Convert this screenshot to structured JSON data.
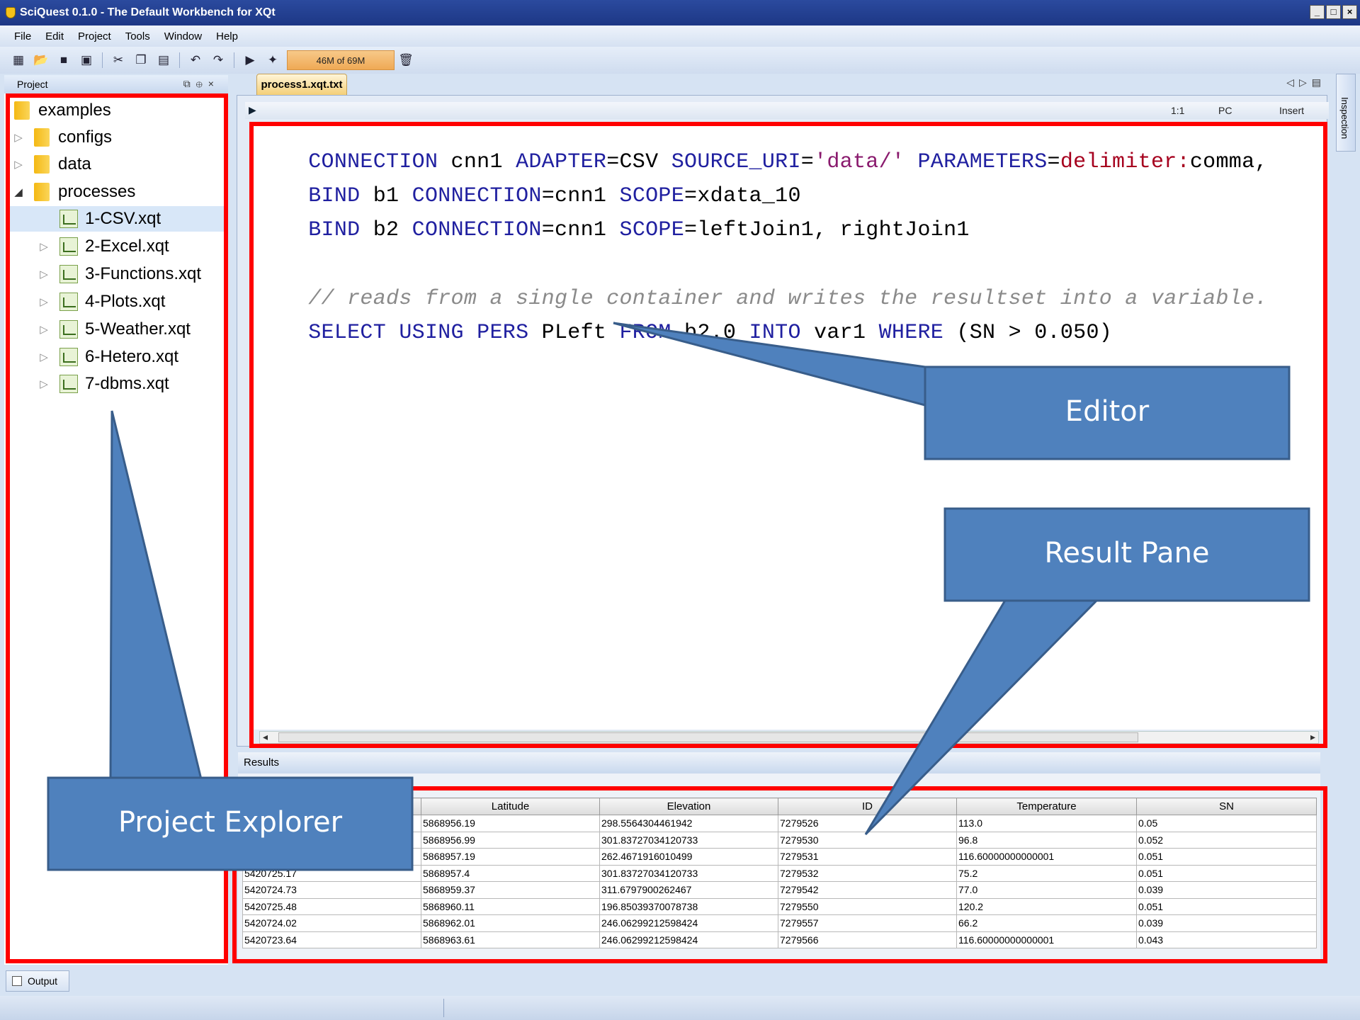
{
  "window": {
    "title": "SciQuest 0.1.0 - The Default Workbench for XQt",
    "controls": [
      "_",
      "□",
      "×"
    ]
  },
  "menu": [
    "File",
    "Edit",
    "Project",
    "Tools",
    "Window",
    "Help"
  ],
  "toolbar": {
    "icons": [
      "new-icon",
      "open-folder-icon",
      "save-icon",
      "save-all-icon",
      "cut-icon",
      "copy-icon",
      "paste-icon",
      "undo-icon",
      "redo-icon",
      "run-icon",
      "debug-icon",
      "trash-icon"
    ],
    "memory": "46M of 69M"
  },
  "project_panel": {
    "title": "Project",
    "tree": [
      {
        "label": "examples",
        "kind": "folder",
        "level": 0,
        "arrow": ""
      },
      {
        "label": "configs",
        "kind": "folder",
        "level": 1,
        "arrow": "▷"
      },
      {
        "label": "data",
        "kind": "folder",
        "level": 1,
        "arrow": "▷"
      },
      {
        "label": "processes",
        "kind": "folder",
        "level": 1,
        "arrow": "◢"
      },
      {
        "label": "1-CSV.xqt",
        "kind": "file",
        "level": 2,
        "arrow": "",
        "selected": true
      },
      {
        "label": "2-Excel.xqt",
        "kind": "file",
        "level": 2,
        "arrow": "▷"
      },
      {
        "label": "3-Functions.xqt",
        "kind": "file",
        "level": 2,
        "arrow": "▷"
      },
      {
        "label": "4-Plots.xqt",
        "kind": "file",
        "level": 2,
        "arrow": "▷"
      },
      {
        "label": "5-Weather.xqt",
        "kind": "file",
        "level": 2,
        "arrow": "▷"
      },
      {
        "label": "6-Hetero.xqt",
        "kind": "file",
        "level": 2,
        "arrow": "▷"
      },
      {
        "label": "7-dbms.xqt",
        "kind": "file",
        "level": 2,
        "arrow": "▷"
      }
    ]
  },
  "editor": {
    "tab": "process1.xqt.txt",
    "status": {
      "position": "1:1",
      "encoding": "PC",
      "mode": "Insert"
    },
    "lines": {
      "l1": {
        "k1": "CONNECTION",
        "t1": " cnn1 ",
        "k2": "ADAPTER",
        "t2": "=CSV ",
        "k3": "SOURCE_URI",
        "t3": "=",
        "s1": "'data/'",
        "t4": " ",
        "k4": "PARAMETERS",
        "t5": "=",
        "p1": "delimiter:",
        "t6": "comma,"
      },
      "l2": {
        "k1": "BIND",
        "t1": " b1 ",
        "k2": "CONNECTION",
        "t2": "=cnn1 ",
        "k3": "SCOPE",
        "t3": "=xdata_10"
      },
      "l3": {
        "k1": "BIND",
        "t1": " b2 ",
        "k2": "CONNECTION",
        "t2": "=cnn1 ",
        "k3": "SCOPE",
        "t3": "=leftJoin1, rightJoin1"
      },
      "l4": {
        "c1": "// reads from a single container and writes the resultset into a variable."
      },
      "l5": {
        "k1": "SELECT USING PERS",
        "t1": " PLeft ",
        "k2": "FROM",
        "t2": " b2.0 ",
        "k3": "INTO",
        "t3": " var1 ",
        "k4": "WHERE",
        "t4": " (SN > 0.050)"
      }
    }
  },
  "results": {
    "title": "Results",
    "columns": [
      "",
      "Latitude",
      "Elevation",
      "ID",
      "Temperature",
      "SN"
    ],
    "rows": [
      [
        "",
        "5868956.19",
        "298.5564304461942",
        "7279526",
        "113.0",
        "0.05"
      ],
      [
        "",
        "5868956.99",
        "301.83727034120733",
        "7279530",
        "96.8",
        "0.052"
      ],
      [
        "",
        "5868957.19",
        "262.4671916010499",
        "7279531",
        "116.60000000000001",
        "0.051"
      ],
      [
        "5420725.17",
        "5868957.4",
        "301.83727034120733",
        "7279532",
        "75.2",
        "0.051"
      ],
      [
        "5420724.73",
        "5868959.37",
        "311.6797900262467",
        "7279542",
        "77.0",
        "0.039"
      ],
      [
        "5420725.48",
        "5868960.11",
        "196.85039370078738",
        "7279550",
        "120.2",
        "0.051"
      ],
      [
        "5420724.02",
        "5868962.01",
        "246.06299212598424",
        "7279557",
        "66.2",
        "0.039"
      ],
      [
        "5420723.64",
        "5868963.61",
        "246.06299212598424",
        "7279566",
        "116.60000000000001",
        "0.043"
      ]
    ]
  },
  "side_panel": {
    "inspection_label": "Inspection"
  },
  "bottom": {
    "output_label": "Output"
  },
  "annotations": {
    "editor": "Editor",
    "result_pane": "Result Pane",
    "project_explorer": "Project Explorer",
    "highlight_color": "#ff0000",
    "callout_fill": "#4f81bd",
    "callout_border": "#385d8a"
  }
}
